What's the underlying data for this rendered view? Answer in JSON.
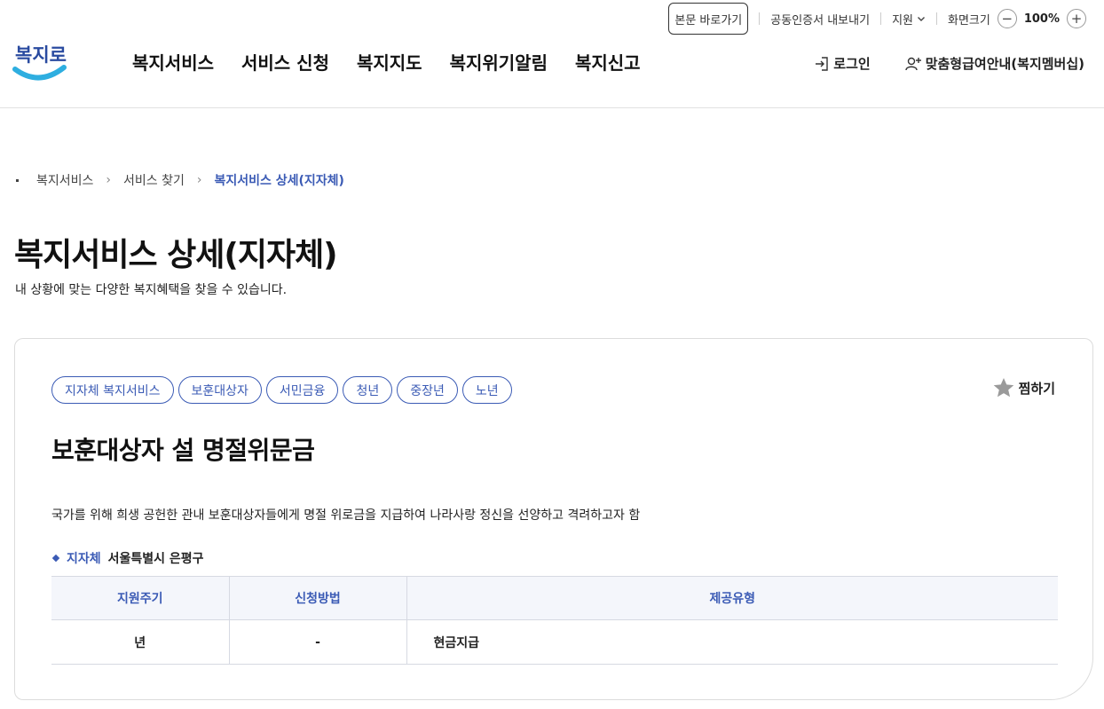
{
  "util": {
    "skip_label": "본문 바로가기",
    "cert_label": "공동인증서 내보내기",
    "support_label": "지원",
    "screen_size_label": "화면크기",
    "zoom_minus": "−",
    "zoom_value": "100%",
    "zoom_plus": "+"
  },
  "header": {
    "logo_text": "복지로",
    "nav": [
      "복지서비스",
      "서비스 신청",
      "복지지도",
      "복지위기알림",
      "복지신고"
    ],
    "login_label": "로그인",
    "membership_label": "맞춤형급여안내(복지멤버십)"
  },
  "breadcrumb": [
    "복지서비스",
    "서비스 찾기",
    "복지서비스 상세(지자체)"
  ],
  "breadcrumb_sep": "›",
  "page": {
    "title": "복지서비스 상세(지자체)",
    "subtitle": "내 상황에 맞는 다양한 복지혜택을 찾을 수 있습니다."
  },
  "service": {
    "tags": [
      "지자체 복지서비스",
      "보훈대상자",
      "서민금융",
      "청년",
      "중장년",
      "노년"
    ],
    "favorite_label": "찜하기",
    "title": "보훈대상자 설 명절위문금",
    "description": "국가를 위해 희생 공헌한 관내 보훈대상자들에게 명절 위로금을 지급하여 나라사랑 정신을 선양하고 격려하고자 함",
    "org_label": "지자체",
    "org_value": "서울특별시 은평구",
    "table": {
      "headers": [
        "지원주기",
        "신청방법",
        "제공유형"
      ],
      "row": [
        "년",
        "-",
        "현금지급"
      ]
    }
  },
  "colors": {
    "accent": "#3b5bb5",
    "logo_blue": "#2eaee0",
    "logo_navy": "#2a4ba0"
  }
}
